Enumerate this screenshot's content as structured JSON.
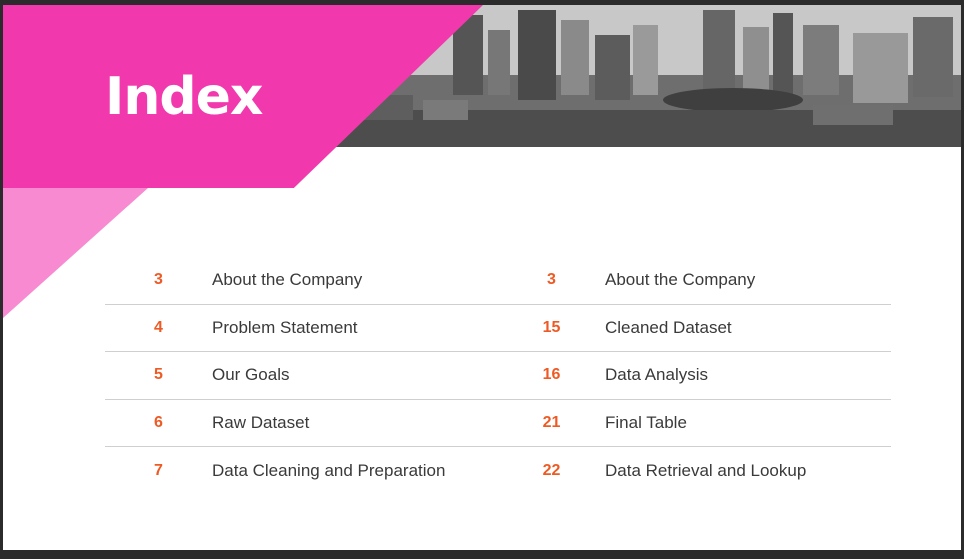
{
  "title": "Index",
  "colors": {
    "accent_pink": "#f238ad",
    "light_pink": "#f78ad0",
    "page_number": "#ee5a24"
  },
  "left_column": [
    {
      "page": "3",
      "label": "About the Company"
    },
    {
      "page": "4",
      "label": "Problem Statement"
    },
    {
      "page": "5",
      "label": "Our Goals"
    },
    {
      "page": "6",
      "label": "Raw Dataset"
    },
    {
      "page": "7",
      "label": "Data Cleaning and Preparation"
    }
  ],
  "right_column": [
    {
      "page": "3",
      "label": "About the Company"
    },
    {
      "page": "15",
      "label": "Cleaned Dataset"
    },
    {
      "page": "16",
      "label": "Data Analysis"
    },
    {
      "page": "21",
      "label": "Final Table"
    },
    {
      "page": "22",
      "label": "Data Retrieval and Lookup"
    }
  ]
}
